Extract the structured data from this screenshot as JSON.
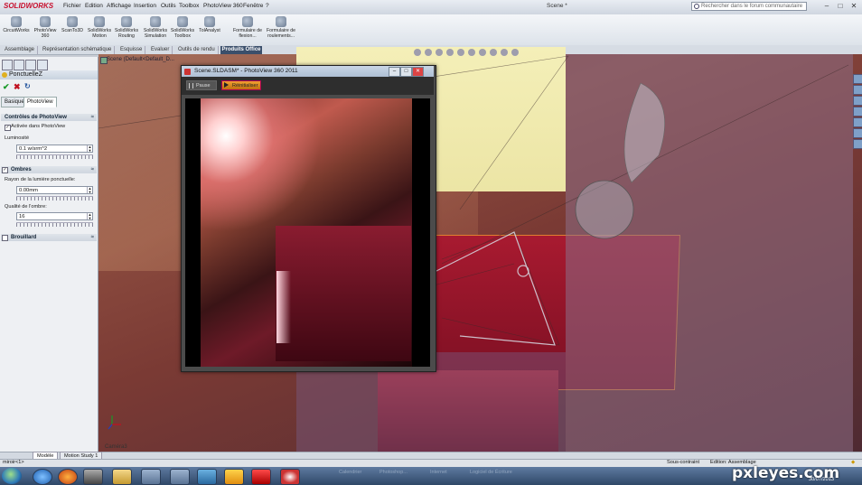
{
  "app": {
    "logo": "SOLIDWORKS",
    "doc_title": "Scene *",
    "search_placeholder": "Rechercher dans le forum communautaire"
  },
  "menu": [
    "Fichier",
    "Edition",
    "Affichage",
    "Insertion",
    "Outils",
    "Toolbox",
    "PhotoView 360",
    "Fenêtre",
    "?"
  ],
  "window_buttons": [
    "–",
    "□",
    "✕"
  ],
  "toolbar": [
    {
      "label": "CircuitWorks",
      "icon": "circuitworks-icon"
    },
    {
      "label": "PhotoView 360",
      "icon": "photoview-icon"
    },
    {
      "label": "ScanTo3D",
      "icon": "scanto3d-icon"
    },
    {
      "label": "SolidWorks Motion",
      "icon": "motion-icon"
    },
    {
      "label": "SolidWorks Routing",
      "icon": "routing-icon"
    },
    {
      "label": "SolidWorks Simulation",
      "icon": "simulation-icon"
    },
    {
      "label": "SolidWorks Toolbox",
      "icon": "toolbox-icon"
    },
    {
      "label": "TolAnalyst",
      "icon": "tolanalyst-icon"
    },
    {
      "label": "Formulaire de flexion...",
      "icon": "flexion-icon"
    },
    {
      "label": "Formulaire de roulements...",
      "icon": "roulements-icon"
    }
  ],
  "products_office": "Produits Office",
  "command_tabs": [
    "Assemblage",
    "Représentation schématique",
    "Esquisse",
    "Evaluer",
    "Outils de rendu"
  ],
  "property": {
    "title": "PonctuelleZ",
    "subtabs": [
      "Basique",
      "PhotoView"
    ],
    "groups": {
      "controls": {
        "title": "Contrôles de PhotoView",
        "checkbox": "Activée dans PhotoView",
        "lum_label": "Luminosité",
        "lum_value": "0.1 w/srm^2"
      },
      "shadows": {
        "title": "Ombres",
        "radius_label": "Rayon de la lumière ponctuelle:",
        "radius_value": "0.00mm",
        "quality_label": "Qualité de l'ombre:",
        "quality_value": "16"
      },
      "fog": {
        "title": "Brouillard"
      }
    }
  },
  "tree": {
    "root": "Scene (Default<Default_D..."
  },
  "camera": "Caméra3",
  "photoview": {
    "title": "Scene.SLDASM* - PhotoView 360 2011",
    "pause": "Pause",
    "reset": "Réinitialiser"
  },
  "bottom_tabs": [
    "Modèle",
    "Motion Study 1"
  ],
  "status": {
    "left": "miroir<1>",
    "constraint": "Sous-contraint",
    "edit": "Edition: Assemblage"
  },
  "taskbar": {
    "clock": "30/07/2013",
    "ghost": [
      "Calendrier",
      "Photoshop...",
      "Internet",
      "Logiciel de Écriture"
    ]
  },
  "watermark": "pxleyes.com"
}
